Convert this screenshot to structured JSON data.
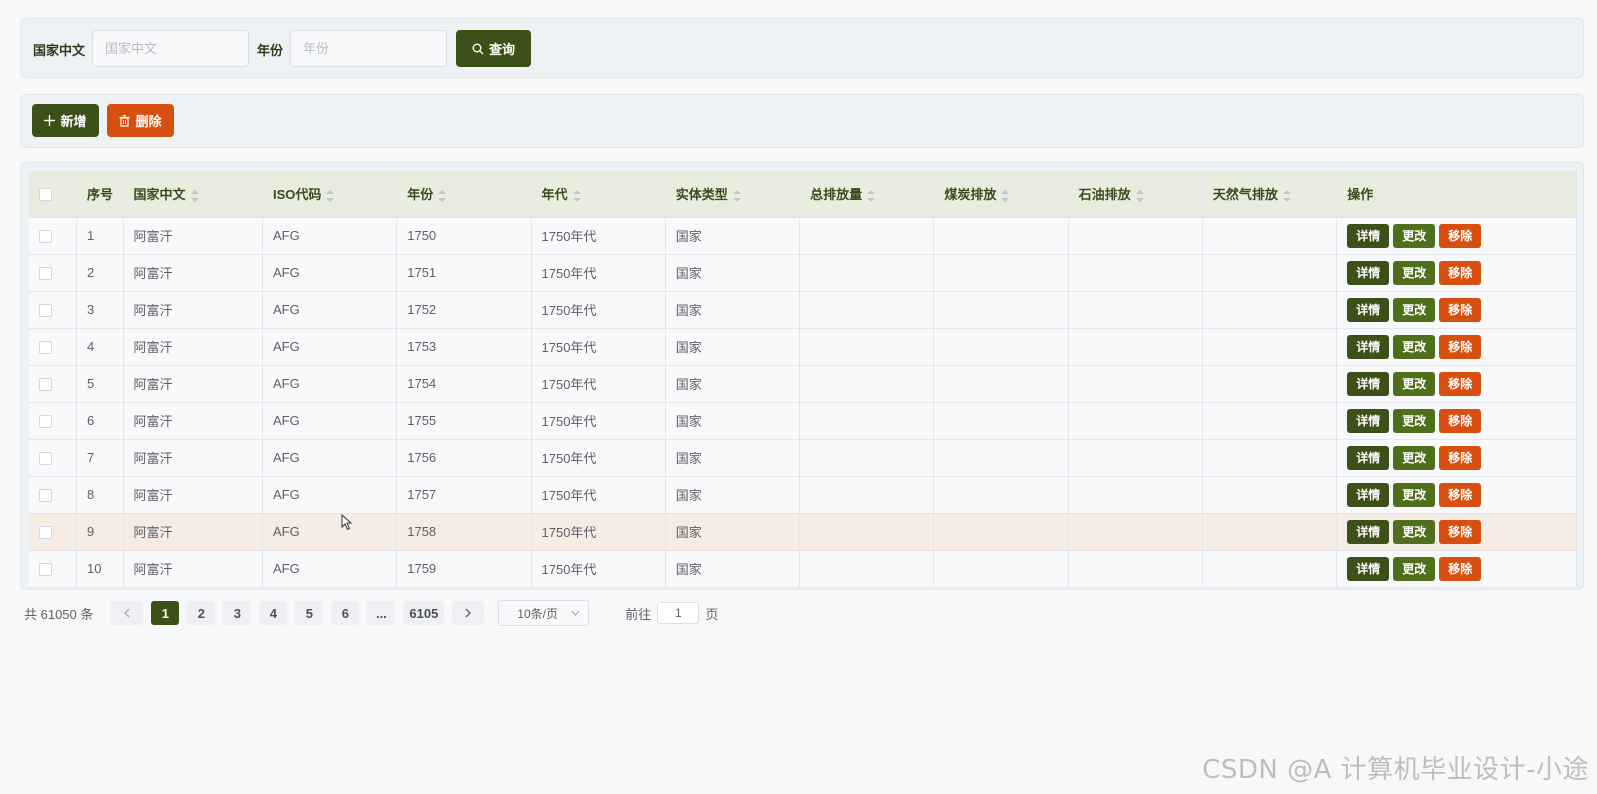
{
  "search": {
    "country_label": "国家中文",
    "country_placeholder": "国家中文",
    "year_label": "年份",
    "year_placeholder": "年份",
    "query_label": "查询"
  },
  "actions": {
    "add_label": "新增",
    "delete_label": "删除"
  },
  "table": {
    "columns": [
      "",
      "序号",
      "国家中文",
      "ISO代码",
      "年份",
      "年代",
      "实体类型",
      "总排放量",
      "煤炭排放",
      "石油排放",
      "天然气排放",
      "操作"
    ],
    "op_labels": {
      "detail": "详情",
      "edit": "更改",
      "remove": "移除"
    },
    "rows": [
      {
        "no": "1",
        "country": "阿富汗",
        "iso": "AFG",
        "year": "1750",
        "decade": "1750年代",
        "entity": "国家",
        "total": "",
        "coal": "",
        "oil": "",
        "gas": ""
      },
      {
        "no": "2",
        "country": "阿富汗",
        "iso": "AFG",
        "year": "1751",
        "decade": "1750年代",
        "entity": "国家",
        "total": "",
        "coal": "",
        "oil": "",
        "gas": ""
      },
      {
        "no": "3",
        "country": "阿富汗",
        "iso": "AFG",
        "year": "1752",
        "decade": "1750年代",
        "entity": "国家",
        "total": "",
        "coal": "",
        "oil": "",
        "gas": ""
      },
      {
        "no": "4",
        "country": "阿富汗",
        "iso": "AFG",
        "year": "1753",
        "decade": "1750年代",
        "entity": "国家",
        "total": "",
        "coal": "",
        "oil": "",
        "gas": ""
      },
      {
        "no": "5",
        "country": "阿富汗",
        "iso": "AFG",
        "year": "1754",
        "decade": "1750年代",
        "entity": "国家",
        "total": "",
        "coal": "",
        "oil": "",
        "gas": ""
      },
      {
        "no": "6",
        "country": "阿富汗",
        "iso": "AFG",
        "year": "1755",
        "decade": "1750年代",
        "entity": "国家",
        "total": "",
        "coal": "",
        "oil": "",
        "gas": ""
      },
      {
        "no": "7",
        "country": "阿富汗",
        "iso": "AFG",
        "year": "1756",
        "decade": "1750年代",
        "entity": "国家",
        "total": "",
        "coal": "",
        "oil": "",
        "gas": ""
      },
      {
        "no": "8",
        "country": "阿富汗",
        "iso": "AFG",
        "year": "1757",
        "decade": "1750年代",
        "entity": "国家",
        "total": "",
        "coal": "",
        "oil": "",
        "gas": ""
      },
      {
        "no": "9",
        "country": "阿富汗",
        "iso": "AFG",
        "year": "1758",
        "decade": "1750年代",
        "entity": "国家",
        "total": "",
        "coal": "",
        "oil": "",
        "gas": ""
      },
      {
        "no": "10",
        "country": "阿富汗",
        "iso": "AFG",
        "year": "1759",
        "decade": "1750年代",
        "entity": "国家",
        "total": "",
        "coal": "",
        "oil": "",
        "gas": ""
      }
    ]
  },
  "pagination": {
    "total_text": "共 61050 条",
    "pages": [
      "1",
      "2",
      "3",
      "4",
      "5",
      "6",
      "...",
      "6105"
    ],
    "current_page": "1",
    "page_size": "10条/页",
    "goto_label": "前往",
    "goto_value": "1",
    "goto_suffix": "页"
  },
  "watermark": "CSDN @A 计算机毕业设计-小途",
  "colors": {
    "primary_dark_green": "#3b5117",
    "edit_green": "#4f6f1c",
    "danger_orange": "#d8500f",
    "header_bg": "#e8ede0",
    "hover_row_bg": "#f7ece4"
  }
}
